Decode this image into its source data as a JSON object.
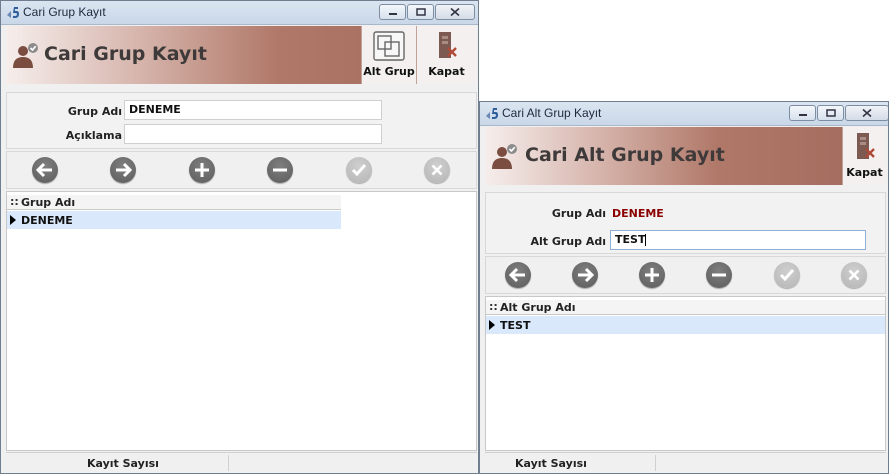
{
  "grup_window": {
    "title": "Cari Grup Kayıt",
    "header_title": "Cari Grup Kayıt",
    "alt_grup_label": "Alt Grup",
    "kapat_label": "Kapat",
    "grup_adi_label": "Grup Adı",
    "grup_adi_value": "DENEME",
    "aciklama_label": "Açıklama",
    "aciklama_value": "",
    "grid": {
      "dots": "::",
      "column": "Grup Adı",
      "rows": [
        "DENEME"
      ]
    },
    "status_label": "Kayıt Sayısı"
  },
  "alt_window": {
    "title": "Cari Alt Grup Kayıt",
    "header_title": "Cari Alt Grup Kayıt",
    "kapat_label": "Kapat",
    "grup_adi_label": "Grup Adı",
    "grup_adi_value": "DENEME",
    "alt_grup_adi_label": "Alt Grup Adı",
    "alt_grup_adi_value": "TEST",
    "grid": {
      "dots": "::",
      "column": "Alt Grup Adı",
      "rows": [
        "TEST"
      ]
    },
    "status_label": "Kayıt Sayısı"
  },
  "nav_icons": [
    "arrow-left-icon",
    "arrow-right-icon",
    "plus-icon",
    "minus-icon",
    "check-icon",
    "x-icon"
  ],
  "colors": {
    "header_accent": "#a06a5c",
    "selected_row": "#d9e8fb",
    "value_red": "#8b0000"
  }
}
